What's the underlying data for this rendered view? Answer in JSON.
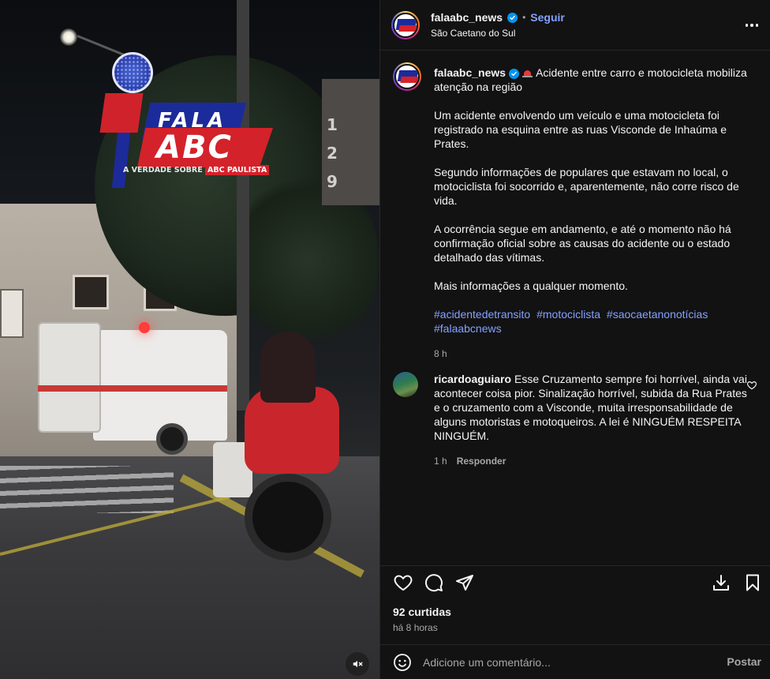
{
  "post": {
    "username": "falaabc_news",
    "follow_label": "Seguir",
    "dot": "•",
    "location": "São Caetano do Sul"
  },
  "media": {
    "logo_fala": "FALA",
    "logo_abc": "ABC",
    "logo_tag_prefix": "A VERDADE SOBRE",
    "logo_tag_highlight": "ABC PAULISTA",
    "building_number": "129",
    "mute_icon": "speaker-muted-icon"
  },
  "caption": {
    "username": "falaabc_news",
    "title": "Acidente entre carro e motocicleta mobiliza atenção na região",
    "paragraphs": [
      "Um acidente envolvendo um veículo e uma motocicleta foi registrado na esquina entre as ruas Visconde de Inhaúma e Prates.",
      "Segundo informações de populares que estavam no local, o motociclista foi socorrido e, aparentemente, não corre risco de vida.",
      "A ocorrência segue em andamento, e até o momento não há confirmação oficial sobre as causas do acidente ou o estado detalhado das vítimas.",
      "Mais informações a qualquer momento."
    ],
    "hashtags": [
      "#acidentedetransito",
      "#motociclista",
      "#saocaetanonotícias",
      "#falaabcnews"
    ],
    "time": "8 h"
  },
  "comment": {
    "username": "ricardoaguiaro",
    "text": "Esse Cruzamento sempre foi horrível, ainda vai acontecer coisa pior. Sinalização horrível, subida da Rua Prates e o cruzamento com a Visconde, muita irresponsabilidade de alguns motoristas e motoqueiros. A lei é NINGUÉM RESPEITA NINGUÉM.",
    "time": "1 h",
    "reply_label": "Responder"
  },
  "actions": {
    "likes": "92 curtidas",
    "posted_ago": "há 8 horas"
  },
  "add_comment": {
    "placeholder": "Adicione um comentário...",
    "post_label": "Postar"
  },
  "colors": {
    "background": "#121212",
    "link": "#85a1ff",
    "verified": "#0095f6",
    "muted_text": "#a8a8a8"
  }
}
